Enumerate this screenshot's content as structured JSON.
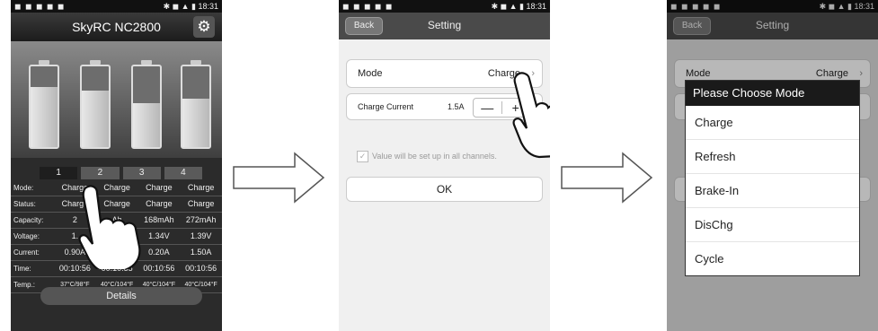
{
  "status": {
    "time": "18:31"
  },
  "screen1": {
    "title": "SkyRC NC2800",
    "gear_icon": "gear-icon",
    "channels": [
      "1",
      "2",
      "3",
      "4"
    ],
    "selected_channel": 0,
    "cells_fill": [
      0.75,
      0.7,
      0.55,
      0.6
    ],
    "table": [
      {
        "label": "Mode:",
        "values": [
          "Charge",
          "Charge",
          "Charge",
          "Charge"
        ]
      },
      {
        "label": "Status:",
        "values": [
          "Charge",
          "Charge",
          "Charge",
          "Charge"
        ]
      },
      {
        "label": "Capacity:",
        "values": [
          "2",
          "Ah",
          "168mAh",
          "272mAh"
        ]
      },
      {
        "label": "Voltage:",
        "values": [
          "1.",
          "V",
          "1.34V",
          "1.39V"
        ]
      },
      {
        "label": "Current:",
        "values": [
          "0.90A",
          "",
          "0.20A",
          "1.50A"
        ]
      },
      {
        "label": "Time:",
        "values": [
          "00:10:56",
          "00:10:55",
          "00:10:56",
          "00:10:56"
        ]
      },
      {
        "label": "Temp.:",
        "values": [
          "37°C/98°F",
          "40°C/104°F",
          "40°C/104°F",
          "40°C/104°F"
        ]
      }
    ],
    "details_label": "Details"
  },
  "screen2": {
    "back_label": "Back",
    "title": "Setting",
    "mode_label": "Mode",
    "mode_value": "Charge",
    "current_label": "Charge Current",
    "current_value": "1.5A",
    "minus": "—",
    "plus": "+",
    "checkbox_text": "Value will be set up in all channels.",
    "ok_label": "OK"
  },
  "screen3": {
    "back_label": "Back",
    "title": "Setting",
    "mode_label": "Mode",
    "mode_value": "Charge",
    "dialog_title": "Please Choose Mode",
    "options": [
      "Charge",
      "Refresh",
      "Brake-In",
      "DisChg",
      "Cycle"
    ]
  }
}
